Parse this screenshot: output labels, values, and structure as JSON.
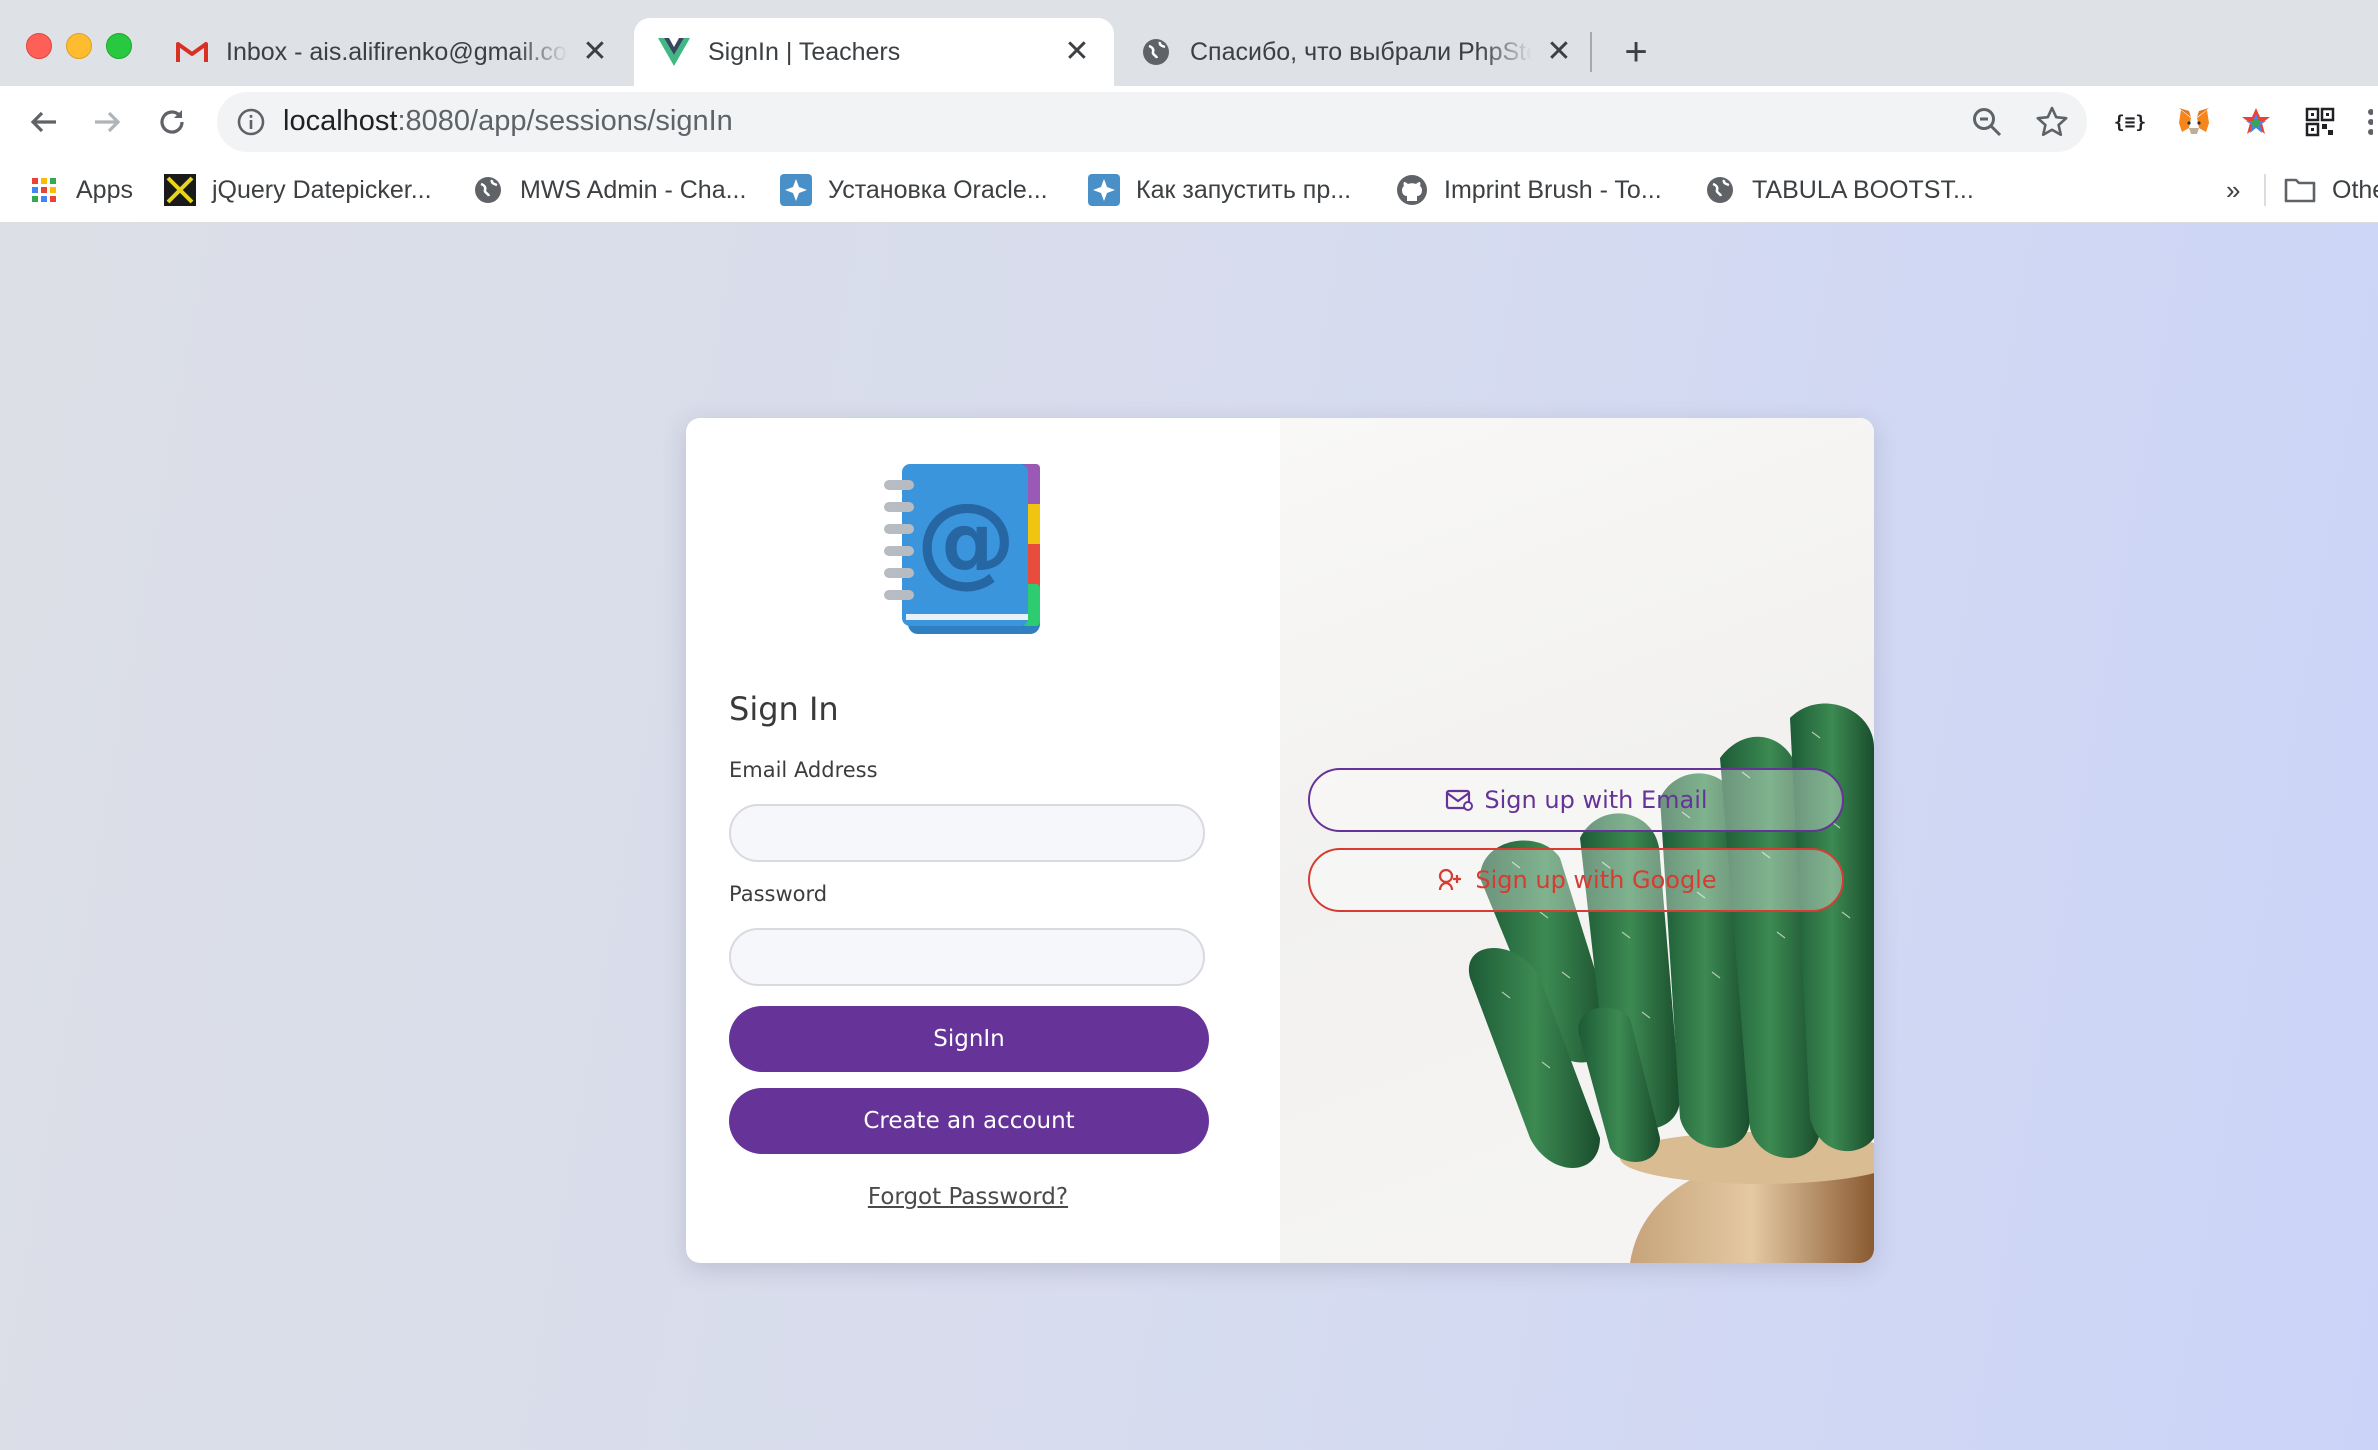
{
  "browser": {
    "tabs": [
      {
        "title": "Inbox - ais.alifirenko@gmail.com",
        "favicon": "gmail-icon",
        "active": false
      },
      {
        "title": "SignIn | Teachers",
        "favicon": "vue-icon",
        "active": true
      },
      {
        "title": "Спасибо, что выбрали PhpStorm",
        "favicon": "globe-icon",
        "active": false
      }
    ],
    "close_glyph": "✕",
    "new_tab_glyph": "+",
    "url_host": "localhost",
    "url_path": ":8080/app/sessions/signIn",
    "bookmarks": [
      {
        "label": "Apps",
        "icon": "apps-grid-icon"
      },
      {
        "label": "jQuery Datepicker...",
        "icon": "jquery-icon"
      },
      {
        "label": "MWS Admin - Cha...",
        "icon": "globe-icon"
      },
      {
        "label": "Установка Oracle...",
        "icon": "confluence-icon"
      },
      {
        "label": "Как запустить пр...",
        "icon": "confluence-icon"
      },
      {
        "label": "Imprint Brush - To...",
        "icon": "github-icon"
      },
      {
        "label": "TABULA BOOTST...",
        "icon": "globe-icon"
      }
    ],
    "bookmarks_overflow": "»",
    "other_bookmarks": "Othe"
  },
  "signin": {
    "title": "Sign In",
    "email_label": "Email Address",
    "email_value": "",
    "password_label": "Password",
    "password_value": "",
    "signin_button": "SignIn",
    "create_account_button": "Create an account",
    "forgot_password": "Forgot Password?",
    "signup_email": "Sign up with Email",
    "signup_google": "Sign up with Google"
  },
  "colors": {
    "primary_purple": "#663399",
    "google_red": "#d63c32",
    "email_purple": "#663399"
  }
}
